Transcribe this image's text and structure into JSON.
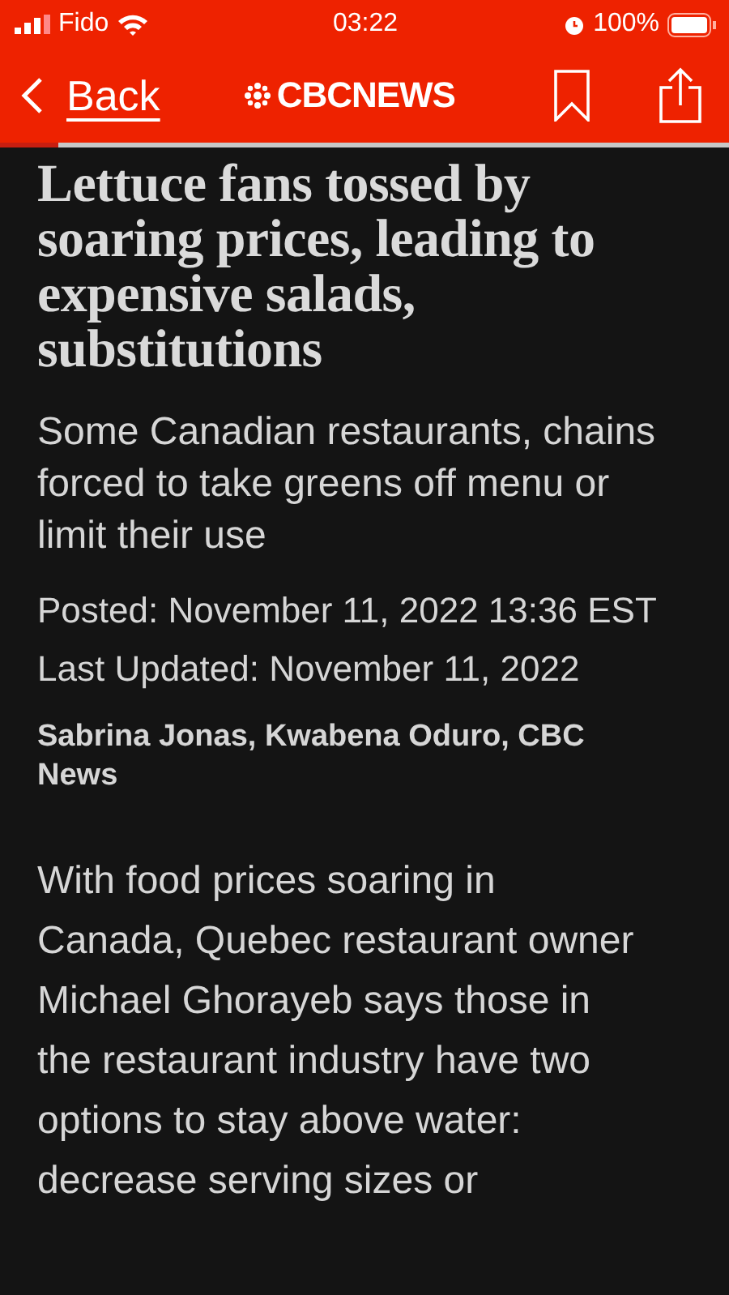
{
  "status_bar": {
    "carrier": "Fido",
    "time": "03:22",
    "battery": "100%"
  },
  "nav_bar": {
    "back": "Back",
    "logo": "CBCNEWS",
    "bookmarked": false
  },
  "reading_progress": {
    "level": 0.08
  },
  "article": {
    "headline": "Lettuce fans tossed by soaring prices, leading to expensive salads, substitutions",
    "subtitle": "Some Canadian restaurants, chains forced to take greens off menu or limit their use",
    "posted": "Posted: November 11, 2022 13:36 EST",
    "updated": "Last Updated: November 11, 2022",
    "byline": "Sabrina Jonas, Kwabena Oduro, CBC News",
    "body": "With food prices soaring in Canada, Quebec restaurant owner Michael Ghorayeb says those in the restaurant industry have two options to stay above water: decrease serving sizes or"
  }
}
